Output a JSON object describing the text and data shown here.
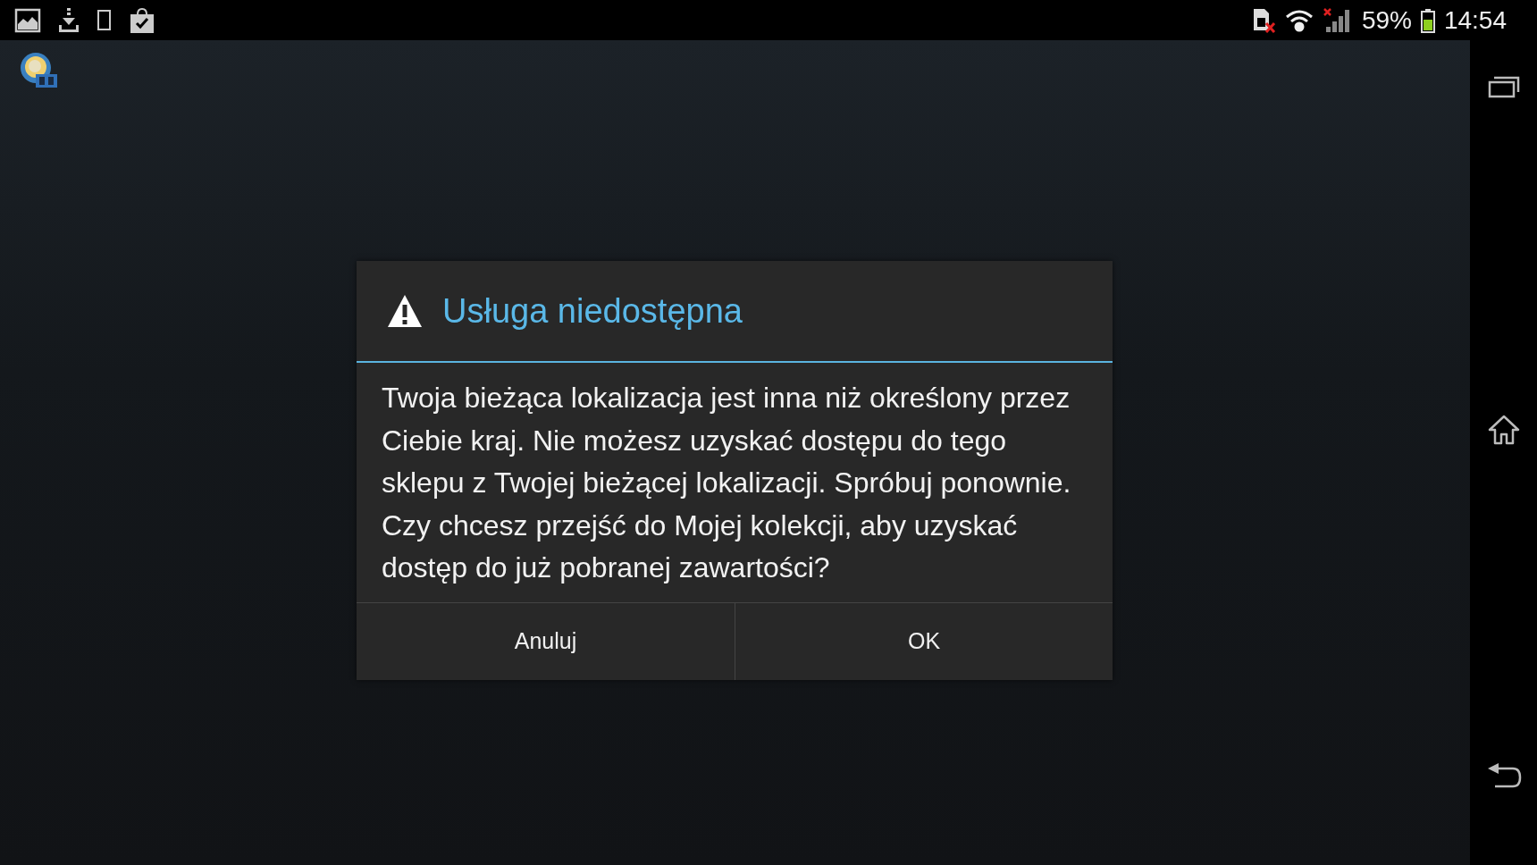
{
  "status_bar": {
    "battery": "59%",
    "time": "14:54"
  },
  "dialog": {
    "title": "Usługa niedostępna",
    "message": "Twoja bieżąca lokalizacja jest inna niż określony przez Ciebie kraj. Nie możesz uzyskać dostępu do tego sklepu z Twojej bieżącej lokalizacji. Spróbuj ponownie. Czy chcesz przejść do Mojej kolekcji, aby uzyskać dostęp do już pobranej zawartości?",
    "buttons": [
      "Anuluj",
      "OK"
    ]
  }
}
